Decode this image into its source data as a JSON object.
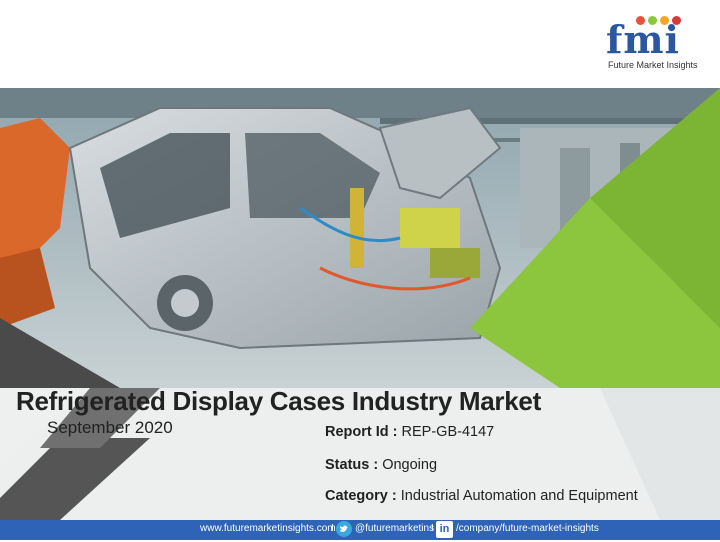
{
  "logo": {
    "letters": "fmi",
    "tagline": "Future Market Insights",
    "dot_colors": [
      "#e7533a",
      "#8cc63f",
      "#f5a623",
      "#d63a3a"
    ]
  },
  "slide": {
    "title": "Refrigerated Display Cases Industry Market",
    "date": "September 2020",
    "report_id_label": "Report Id :",
    "report_id_value": "REP-GB-4147",
    "status_label": "Status :",
    "status_value": "Ongoing",
    "category_label": "Category :",
    "category_value": "Industrial Automation and Equipment"
  },
  "footer": {
    "website": "www.futuremarketinsights.com",
    "separator": "I",
    "twitter": "@futuremarketins",
    "linkedin_letters": "in",
    "linkedin": "/company/future-market-insights"
  },
  "colors": {
    "brand_blue": "#2f63b8",
    "accent_green": "#8cc63f",
    "dark_gray": "#4a4a4a"
  }
}
